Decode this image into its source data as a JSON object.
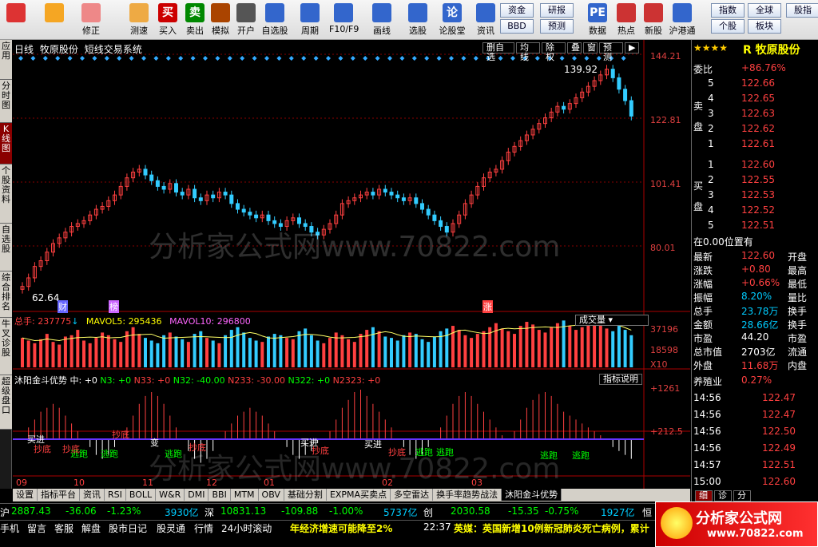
{
  "toolbar": {
    "items": [
      {
        "name": "home-button",
        "label": "",
        "icon": "home-icon",
        "color": "#d33"
      },
      {
        "name": "back-button",
        "label": "",
        "icon": "back-arrow-icon",
        "color": "#f5a623"
      },
      {
        "name": "revise-button",
        "label": "修正",
        "icon": "revise-icon",
        "color": "#e88"
      },
      {
        "name": "backtest-button",
        "label": "测速",
        "icon": "clock-icon",
        "color": "#ea4"
      },
      {
        "name": "buy-button",
        "label": "买入",
        "icon": "buy-icon",
        "glyph": "买",
        "color": "#c00"
      },
      {
        "name": "sell-button",
        "label": "卖出",
        "icon": "sell-icon",
        "glyph": "卖",
        "color": "#080"
      },
      {
        "name": "simulate-button",
        "label": "模拟",
        "icon": "hammer-icon",
        "color": "#a40"
      },
      {
        "name": "open-account-button",
        "label": "开户",
        "icon": "person-icon",
        "color": "#555"
      },
      {
        "name": "watchlist-button",
        "label": "自选股",
        "icon": "star-icon",
        "color": "#36c"
      },
      {
        "name": "period-button",
        "label": "周期",
        "icon": "clock-icon",
        "color": "#36c"
      },
      {
        "name": "f10-button",
        "label": "F10/F9",
        "icon": "document-icon",
        "color": "#36c"
      },
      {
        "name": "draw-button",
        "label": "画线",
        "icon": "pencil-icon",
        "color": "#36c"
      },
      {
        "name": "select-stock-button",
        "label": "选股",
        "icon": "chart-icon",
        "color": "#36c"
      },
      {
        "name": "forum-button",
        "label": "论股堂",
        "icon": "forum-icon",
        "glyph": "论",
        "color": "#36c"
      },
      {
        "name": "news-button",
        "label": "资讯",
        "icon": "news-icon",
        "color": "#36c"
      },
      {
        "name": "data-button",
        "label": "数据",
        "icon": "pe-icon",
        "glyph": "PE",
        "color": "#36c"
      },
      {
        "name": "hot-button",
        "label": "热点",
        "icon": "hot-icon",
        "color": "#c33"
      },
      {
        "name": "ipo-button",
        "label": "新股",
        "icon": "new-stock-icon",
        "color": "#c33"
      },
      {
        "name": "sh-hk-button",
        "label": "沪港通",
        "icon": "sh-hk-icon",
        "color": "#36c"
      }
    ],
    "small_buttons": [
      {
        "name": "funds-button",
        "label": "资金"
      },
      {
        "name": "research-button",
        "label": "研报"
      },
      {
        "name": "bbd-button",
        "label": "BBD"
      },
      {
        "name": "forecast-button",
        "label": "预测"
      },
      {
        "name": "index-button",
        "label": "指数"
      },
      {
        "name": "global-button",
        "label": "全球"
      },
      {
        "name": "stock-report-button",
        "label": "股指"
      },
      {
        "name": "stock-button",
        "label": "个股"
      },
      {
        "name": "sector-button",
        "label": "板块"
      }
    ]
  },
  "left_tabs": [
    {
      "label": "应用"
    },
    {
      "label": "分时图"
    },
    {
      "label": "K线图",
      "active": true
    },
    {
      "label": "个股资料"
    },
    {
      "label": "自选股"
    },
    {
      "label": "综合排名"
    },
    {
      "label": "牛叉诊股"
    },
    {
      "label": "超级盘口"
    }
  ],
  "chart_header": {
    "period": "日线",
    "stock": "牧原股份",
    "system": "短线交易系统"
  },
  "chart_tabs": [
    "删自选",
    "均线",
    "除权",
    "叠",
    "窗",
    "预测"
  ],
  "price_axis": [
    "144.21",
    "122.81",
    "101.41",
    "80.01"
  ],
  "annotations": {
    "high": "139.92",
    "low": "62.64",
    "markers": [
      "财",
      "榜",
      "涨"
    ]
  },
  "watermark": "分析家公式网www.70822.com",
  "volume_header": {
    "label": "总手",
    "value": "237775",
    "arrow": "↓",
    "ma5_label": "MAVOL5",
    "ma5": "295436",
    "ma10_label": "MAVOL10",
    "ma10": "296800"
  },
  "volume_selector": "成交量",
  "volume_axis": [
    "37196",
    "18598",
    "X10"
  ],
  "indicator_header": {
    "name": "沐阳金斗优势",
    "mid": "中: +0",
    "items": [
      {
        "label": "N3: +0",
        "color": "#00ff00"
      },
      {
        "label": "N33: +0",
        "color": "#ff4040"
      },
      {
        "label": "N32: -40.00",
        "color": "#00ff00"
      },
      {
        "label": "N233: -30.00",
        "color": "#ff4040"
      },
      {
        "label": "N322: +0",
        "color": "#00ff00"
      },
      {
        "label": "N2323: +0",
        "color": "#ff4040"
      }
    ]
  },
  "indicator_help": "指标说明",
  "indicator_axis": [
    "+1261",
    "+212.5"
  ],
  "indicator_labels": [
    "买进",
    "抄底",
    "逃跑",
    "逃跑",
    "抄底",
    "抄底",
    "变",
    "逃跑",
    "抄底",
    "买进",
    "抄底",
    "买进",
    "抄底",
    "逃跑",
    "逃跑",
    "逃跑",
    "逃跑"
  ],
  "x_axis": [
    "09",
    "10",
    "11",
    "12",
    "01",
    "02",
    "03"
  ],
  "bottom_tabs": [
    "设置",
    "指标平台",
    "资讯",
    "RSI",
    "BOLL",
    "W&R",
    "DMI",
    "BBI",
    "MTM",
    "OBV",
    "基础分割",
    "EXPMA买卖点",
    "多空雷达",
    "换手率趋势战法",
    "沐阳金斗优势"
  ],
  "active_bottom_tab": "沐阳金斗优势",
  "quote": {
    "title": "R 牧原股份",
    "stars": "★★★★",
    "wei_bi_label": "委比",
    "wei_bi": "+86.76%",
    "sell_label": "卖盘",
    "sell": [
      [
        "5",
        "122.66"
      ],
      [
        "4",
        "122.65"
      ],
      [
        "3",
        "122.63"
      ],
      [
        "2",
        "122.62"
      ],
      [
        "1",
        "122.61"
      ]
    ],
    "buy_label": "买盘",
    "buy": [
      [
        "1",
        "122.60"
      ],
      [
        "2",
        "122.55"
      ],
      [
        "3",
        "122.53"
      ],
      [
        "4",
        "122.52"
      ],
      [
        "5",
        "122.51"
      ]
    ],
    "position": "在0.00位置有",
    "stats": [
      {
        "label": "最新",
        "value": "122.60",
        "color": "#ff4040",
        "right": "开盘"
      },
      {
        "label": "涨跌",
        "value": "+0.80",
        "color": "#ff4040",
        "right": "最高"
      },
      {
        "label": "涨幅",
        "value": "+0.66%",
        "color": "#ff4040",
        "right": "最低"
      },
      {
        "label": "振幅",
        "value": "8.20%",
        "color": "#00ccff",
        "right": "量比"
      },
      {
        "label": "总手",
        "value": "23.78万",
        "color": "#00ccff",
        "right": "换手"
      },
      {
        "label": "金额",
        "value": "28.66亿",
        "color": "#00ccff",
        "right": "换手"
      },
      {
        "label": "市盈",
        "value": "44.20",
        "color": "#fff",
        "right": "市盈"
      },
      {
        "label": "总市值",
        "value": "2703亿",
        "color": "#fff",
        "right": "流通"
      },
      {
        "label": "外盘",
        "value": "11.68万",
        "color": "#ff4040",
        "right": "内盘"
      }
    ],
    "industry": "养殖业",
    "industry_value": "0.27%",
    "ticks": [
      [
        "14:56",
        "122.47"
      ],
      [
        "14:56",
        "122.47"
      ],
      [
        "14:56",
        "122.50"
      ],
      [
        "14:56",
        "122.49"
      ],
      [
        "14:57",
        "122.51"
      ],
      [
        "15:00",
        "122.60"
      ]
    ],
    "tabs": [
      "细",
      "诊",
      "分"
    ]
  },
  "status_bar": {
    "sh_label": "沪",
    "sh": "2887.43",
    "sh_chg": "-36.06",
    "sh_pct": "-1.23%",
    "sh_amt": "3930亿",
    "sz_label": "深",
    "sz": "10831.13",
    "sz_chg": "-109.88",
    "sz_pct": "-1.00%",
    "sz_amt": "5737亿",
    "cy_label": "创",
    "cy": "2030.58",
    "cy_chg": "-15.35",
    "cy_pct": "-0.75%",
    "cy_amt": "1927亿",
    "tail": "恒"
  },
  "status_bar2": {
    "items": [
      "手机",
      "留言",
      "客服",
      "解盘",
      "股市日记",
      "股灵通",
      "行情",
      "24小时滚动"
    ],
    "news1": "年经济增速可能降至2%",
    "time": "22:37",
    "news2": "英媒：英国新增10例新冠肺炎死亡病例，累计"
  },
  "logo": {
    "line1": "分析家公式网",
    "line2": "www.70822.com"
  },
  "chart_data": {
    "type": "candlestick",
    "title": "牧原股份 日线",
    "ylim": [
      62.64,
      144.21
    ],
    "x_ticks": [
      "09",
      "10",
      "11",
      "12",
      "01",
      "02",
      "03"
    ],
    "high": 139.92,
    "low": 62.64,
    "close_series": [
      63,
      66,
      70,
      72,
      75,
      78,
      80,
      82,
      84,
      85,
      86,
      88,
      90,
      91,
      93,
      95,
      98,
      101,
      103,
      104,
      102,
      100,
      98,
      97,
      99,
      96,
      95,
      97,
      94,
      93,
      95,
      94,
      96,
      95,
      92,
      90,
      89,
      88,
      87,
      88,
      86,
      85,
      84,
      86,
      87,
      85,
      84,
      82,
      81,
      83,
      85,
      88,
      92,
      93,
      94,
      95,
      96,
      95,
      97,
      96,
      95,
      94,
      93,
      94,
      92,
      90,
      88,
      86,
      84,
      82,
      85,
      88,
      92,
      95,
      98,
      101,
      103,
      104,
      107,
      110,
      112,
      114,
      116,
      118,
      120,
      122,
      124,
      126,
      125,
      127,
      129,
      131,
      133,
      135,
      137,
      139,
      136,
      132,
      128,
      122.6
    ],
    "volume_series": [
      22,
      20,
      18,
      21,
      25,
      19,
      17,
      23,
      24,
      28,
      20,
      18,
      22,
      26,
      24,
      21,
      19,
      27,
      30,
      25,
      22,
      20,
      18,
      24,
      26,
      23,
      21,
      19,
      25,
      27,
      22,
      20,
      18,
      24,
      28,
      30,
      26,
      22,
      20,
      19,
      23,
      25,
      24,
      22,
      21,
      27,
      29,
      24,
      20,
      18,
      22,
      26,
      24,
      21,
      19,
      25,
      28,
      30,
      27,
      23,
      22,
      20,
      24,
      26,
      25,
      21,
      19,
      23,
      27,
      29,
      31,
      28,
      24,
      22,
      25,
      27,
      30,
      33,
      29,
      27,
      25,
      31,
      34,
      32,
      28,
      26,
      30,
      33,
      35,
      31,
      28,
      30,
      34,
      37,
      33,
      29,
      27,
      31,
      28,
      24
    ],
    "indicator_series": [
      0,
      300,
      500,
      700,
      800,
      900,
      800,
      600,
      400,
      200,
      0,
      -200,
      -400,
      -500,
      -400,
      -200,
      0,
      300,
      600,
      900,
      1100,
      1200,
      1100,
      900,
      600,
      300,
      0,
      -300,
      -500,
      -600,
      -500,
      -300,
      0,
      200,
      400,
      600,
      700,
      800,
      700,
      600,
      400,
      200,
      0,
      -200,
      -400,
      -500,
      -400,
      -300,
      -100,
      0,
      200,
      500,
      800,
      1000,
      1200,
      1261,
      1100,
      900,
      700,
      500,
      300,
      0,
      -200,
      -400,
      -500,
      -400,
      -200,
      0,
      300,
      600,
      900,
      1100,
      1200,
      1100,
      900,
      700,
      500,
      300,
      100,
      0,
      200,
      500,
      800,
      1000,
      1150,
      1200,
      1100,
      900,
      700,
      600,
      500,
      400,
      300,
      200,
      100,
      0,
      -200,
      -300,
      -400,
      -500
    ]
  }
}
